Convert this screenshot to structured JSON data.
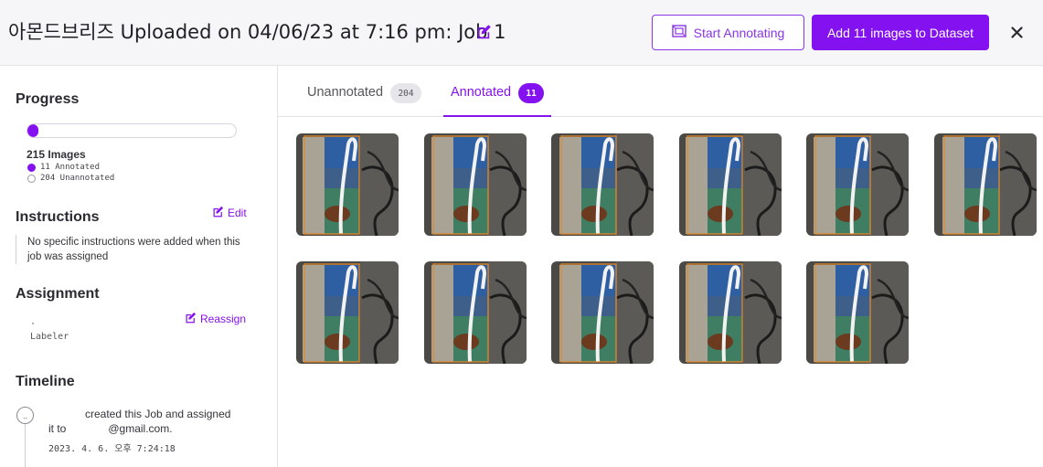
{
  "header": {
    "title": "아몬드브리즈 Uploaded on 04/06/23 at 7:16 pm: Job 1",
    "start_annotating_label": "Start Annotating",
    "add_to_dataset_label": "Add 11 images to Dataset"
  },
  "sidebar": {
    "progress": {
      "title": "Progress",
      "annotated_fraction": 0.0512,
      "images_label": "215 Images",
      "annotated_label": "11 Annotated",
      "unannotated_label": "204 Unannotated"
    },
    "instructions": {
      "title": "Instructions",
      "edit_label": "Edit",
      "text": "No specific instructions were added when this job was assigned"
    },
    "assignment": {
      "title": "Assignment",
      "reassign_label": "Reassign",
      "role": "Labeler"
    },
    "timeline": {
      "title": "Timeline",
      "event_part1": "created this Job and assigned",
      "event_part2_prefix": "it to",
      "event_part2_suffix": "@gmail.com.",
      "timestamp": "2023. 4. 6. 오후 7:24:18"
    }
  },
  "tabs": {
    "unannotated": {
      "label": "Unannotated",
      "count": "204"
    },
    "annotated": {
      "label": "Annotated",
      "count": "11"
    }
  },
  "images": {
    "count": 11
  },
  "colors": {
    "accent": "#8411ef",
    "accent_border": "#8a35e6",
    "bbox_outline": "#e08a2c",
    "header_bg": "#f6f6f8"
  },
  "icons": {
    "title_edit": "pencil-square-icon",
    "start_annotating": "frame-icon",
    "close": "close-icon",
    "edit": "pencil-square-icon",
    "reassign": "pencil-square-icon",
    "timeline_avatar": "avatar-icon"
  }
}
